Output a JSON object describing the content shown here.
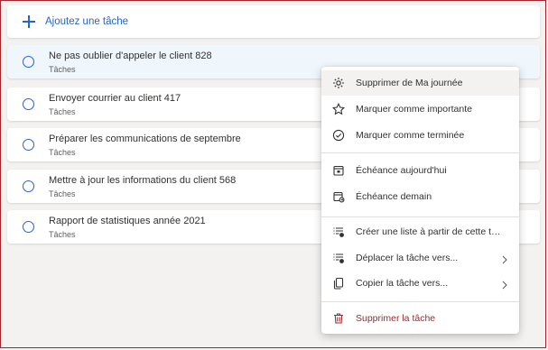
{
  "add_task": {
    "label": "Ajoutez une tâche",
    "icon": "plus-icon"
  },
  "tasks": [
    {
      "title": "Ne pas oublier d'appeler le client 828",
      "list": "Tâches",
      "selected": true
    },
    {
      "title": "Envoyer courrier au client 417",
      "list": "Tâches",
      "selected": false
    },
    {
      "title": "Préparer les communications de septembre",
      "list": "Tâches",
      "selected": false
    },
    {
      "title": "Mettre à jour les informations du client 568",
      "list": "Tâches",
      "selected": false
    },
    {
      "title": "Rapport de statistiques année 2021",
      "list": "Tâches",
      "selected": false
    }
  ],
  "context_menu": {
    "items": [
      {
        "label": "Supprimer de Ma journée",
        "icon": "sun-icon"
      },
      {
        "label": "Marquer comme importante",
        "icon": "star-icon"
      },
      {
        "label": "Marquer comme terminée",
        "icon": "check-circle-icon"
      },
      {
        "label": "Échéance aujourd'hui",
        "icon": "calendar-today-icon"
      },
      {
        "label": "Échéance demain",
        "icon": "calendar-tomorrow-icon"
      },
      {
        "label": "Créer une liste à partir de cette tâche",
        "icon": "list-add-icon"
      },
      {
        "label": "Déplacer la tâche vers...",
        "icon": "list-move-icon"
      },
      {
        "label": "Copier la tâche vers...",
        "icon": "copy-icon"
      },
      {
        "label": "Supprimer la tâche",
        "icon": "trash-icon"
      }
    ]
  },
  "colors": {
    "accent": "#2564cf",
    "danger": "#a4262c",
    "selected_bg": "#eff6fc"
  }
}
